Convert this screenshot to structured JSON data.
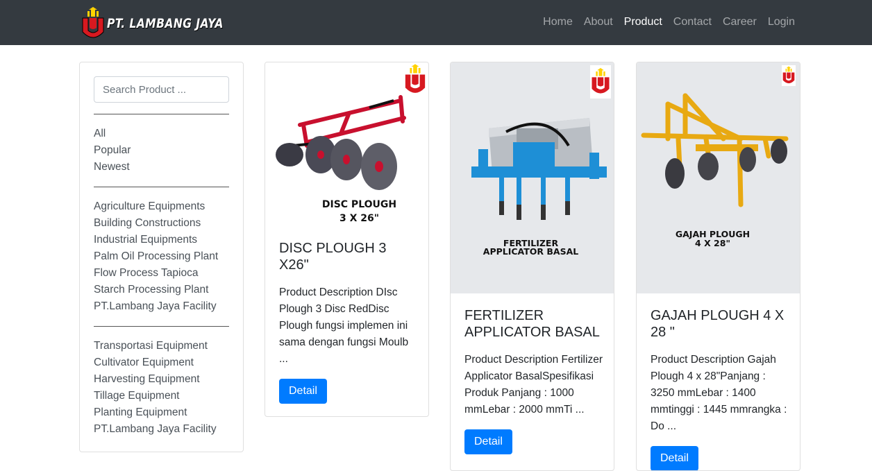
{
  "nav": {
    "brand": "PT. LAMBANG JAYA",
    "links": [
      "Home",
      "About",
      "Product",
      "Contact",
      "Career",
      "Login"
    ],
    "active": "Product"
  },
  "sidebar": {
    "search_placeholder": "Search Product ...",
    "filters": [
      "All",
      "Popular",
      "Newest"
    ],
    "categories": [
      "Agriculture Equipments",
      "Building Constructions",
      "Industrial Equipments",
      "Palm Oil Processing Plant",
      "Flow Process Tapioca",
      "Starch Processing Plant",
      "PT.Lambang Jaya Facility"
    ],
    "types": [
      "Transportasi Equipment",
      "Cultivator Equipment",
      "Harvesting Equipment",
      "Tillage Equipment",
      "Planting Equipment",
      "PT.Lambang Jaya Facility"
    ]
  },
  "products": [
    {
      "title": "DISC PLOUGH 3 X26\"",
      "description": "Product Description DIsc Plough 3 Disc RedDisc Plough fungsi implemen ini sama dengan fungsi Moulb ...",
      "button": "Detail",
      "image_caption_line1": "DISC PLOUGH",
      "image_caption_line2": "3 X 26\""
    },
    {
      "title": "FERTILIZER APPLICATOR BASAL",
      "description": "Product Description Fertilizer Applicator BasalSpesifikasi Produk Panjang : 1000 mmLebar : 2000 mmTi ...",
      "button": "Detail",
      "image_caption_line1": "FERTILIZER",
      "image_caption_line2": "APPLICATOR BASAL"
    },
    {
      "title": "GAJAH PLOUGH 4 X 28 \"",
      "description": "Product Description Gajah Plough 4 x 28\"Panjang : 3250 mmLebar : 1400 mmtinggi : 1445 mmrangka : Do ...",
      "button": "Detail",
      "image_caption_line1": "GAJAH PLOUGH",
      "image_caption_line2": "4 X 28\""
    }
  ],
  "colors": {
    "navbar": "#343a40",
    "primary": "#007bff",
    "logo_red": "#d71920",
    "logo_yellow": "#ffd200"
  }
}
